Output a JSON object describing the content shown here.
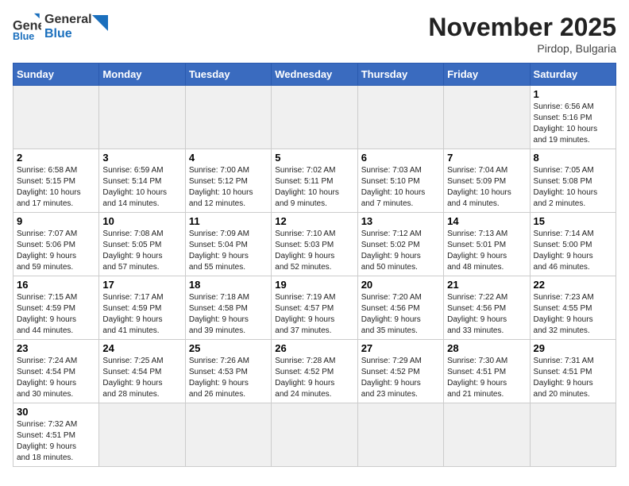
{
  "header": {
    "logo_general": "General",
    "logo_blue": "Blue",
    "month_title": "November 2025",
    "subtitle": "Pirdop, Bulgaria"
  },
  "weekdays": [
    "Sunday",
    "Monday",
    "Tuesday",
    "Wednesday",
    "Thursday",
    "Friday",
    "Saturday"
  ],
  "weeks": [
    [
      {
        "day": "",
        "info": ""
      },
      {
        "day": "",
        "info": ""
      },
      {
        "day": "",
        "info": ""
      },
      {
        "day": "",
        "info": ""
      },
      {
        "day": "",
        "info": ""
      },
      {
        "day": "",
        "info": ""
      },
      {
        "day": "1",
        "info": "Sunrise: 6:56 AM\nSunset: 5:16 PM\nDaylight: 10 hours\nand 19 minutes."
      }
    ],
    [
      {
        "day": "2",
        "info": "Sunrise: 6:58 AM\nSunset: 5:15 PM\nDaylight: 10 hours\nand 17 minutes."
      },
      {
        "day": "3",
        "info": "Sunrise: 6:59 AM\nSunset: 5:14 PM\nDaylight: 10 hours\nand 14 minutes."
      },
      {
        "day": "4",
        "info": "Sunrise: 7:00 AM\nSunset: 5:12 PM\nDaylight: 10 hours\nand 12 minutes."
      },
      {
        "day": "5",
        "info": "Sunrise: 7:02 AM\nSunset: 5:11 PM\nDaylight: 10 hours\nand 9 minutes."
      },
      {
        "day": "6",
        "info": "Sunrise: 7:03 AM\nSunset: 5:10 PM\nDaylight: 10 hours\nand 7 minutes."
      },
      {
        "day": "7",
        "info": "Sunrise: 7:04 AM\nSunset: 5:09 PM\nDaylight: 10 hours\nand 4 minutes."
      },
      {
        "day": "8",
        "info": "Sunrise: 7:05 AM\nSunset: 5:08 PM\nDaylight: 10 hours\nand 2 minutes."
      }
    ],
    [
      {
        "day": "9",
        "info": "Sunrise: 7:07 AM\nSunset: 5:06 PM\nDaylight: 9 hours\nand 59 minutes."
      },
      {
        "day": "10",
        "info": "Sunrise: 7:08 AM\nSunset: 5:05 PM\nDaylight: 9 hours\nand 57 minutes."
      },
      {
        "day": "11",
        "info": "Sunrise: 7:09 AM\nSunset: 5:04 PM\nDaylight: 9 hours\nand 55 minutes."
      },
      {
        "day": "12",
        "info": "Sunrise: 7:10 AM\nSunset: 5:03 PM\nDaylight: 9 hours\nand 52 minutes."
      },
      {
        "day": "13",
        "info": "Sunrise: 7:12 AM\nSunset: 5:02 PM\nDaylight: 9 hours\nand 50 minutes."
      },
      {
        "day": "14",
        "info": "Sunrise: 7:13 AM\nSunset: 5:01 PM\nDaylight: 9 hours\nand 48 minutes."
      },
      {
        "day": "15",
        "info": "Sunrise: 7:14 AM\nSunset: 5:00 PM\nDaylight: 9 hours\nand 46 minutes."
      }
    ],
    [
      {
        "day": "16",
        "info": "Sunrise: 7:15 AM\nSunset: 4:59 PM\nDaylight: 9 hours\nand 44 minutes."
      },
      {
        "day": "17",
        "info": "Sunrise: 7:17 AM\nSunset: 4:59 PM\nDaylight: 9 hours\nand 41 minutes."
      },
      {
        "day": "18",
        "info": "Sunrise: 7:18 AM\nSunset: 4:58 PM\nDaylight: 9 hours\nand 39 minutes."
      },
      {
        "day": "19",
        "info": "Sunrise: 7:19 AM\nSunset: 4:57 PM\nDaylight: 9 hours\nand 37 minutes."
      },
      {
        "day": "20",
        "info": "Sunrise: 7:20 AM\nSunset: 4:56 PM\nDaylight: 9 hours\nand 35 minutes."
      },
      {
        "day": "21",
        "info": "Sunrise: 7:22 AM\nSunset: 4:56 PM\nDaylight: 9 hours\nand 33 minutes."
      },
      {
        "day": "22",
        "info": "Sunrise: 7:23 AM\nSunset: 4:55 PM\nDaylight: 9 hours\nand 32 minutes."
      }
    ],
    [
      {
        "day": "23",
        "info": "Sunrise: 7:24 AM\nSunset: 4:54 PM\nDaylight: 9 hours\nand 30 minutes."
      },
      {
        "day": "24",
        "info": "Sunrise: 7:25 AM\nSunset: 4:54 PM\nDaylight: 9 hours\nand 28 minutes."
      },
      {
        "day": "25",
        "info": "Sunrise: 7:26 AM\nSunset: 4:53 PM\nDaylight: 9 hours\nand 26 minutes."
      },
      {
        "day": "26",
        "info": "Sunrise: 7:28 AM\nSunset: 4:52 PM\nDaylight: 9 hours\nand 24 minutes."
      },
      {
        "day": "27",
        "info": "Sunrise: 7:29 AM\nSunset: 4:52 PM\nDaylight: 9 hours\nand 23 minutes."
      },
      {
        "day": "28",
        "info": "Sunrise: 7:30 AM\nSunset: 4:51 PM\nDaylight: 9 hours\nand 21 minutes."
      },
      {
        "day": "29",
        "info": "Sunrise: 7:31 AM\nSunset: 4:51 PM\nDaylight: 9 hours\nand 20 minutes."
      }
    ],
    [
      {
        "day": "30",
        "info": "Sunrise: 7:32 AM\nSunset: 4:51 PM\nDaylight: 9 hours\nand 18 minutes."
      },
      {
        "day": "",
        "info": ""
      },
      {
        "day": "",
        "info": ""
      },
      {
        "day": "",
        "info": ""
      },
      {
        "day": "",
        "info": ""
      },
      {
        "day": "",
        "info": ""
      },
      {
        "day": "",
        "info": ""
      }
    ]
  ]
}
